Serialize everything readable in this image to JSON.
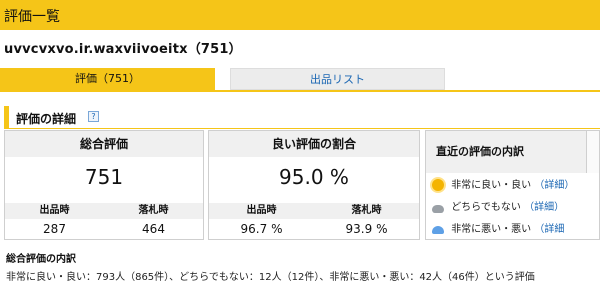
{
  "page": {
    "title": "評価一覧",
    "user_line": "uvvcvxvo.ir.waxviivoeitx（751）"
  },
  "tabs": {
    "active": "評価（751）",
    "inactive": "出品リスト"
  },
  "section": {
    "title": "評価の詳細",
    "help_icon_label": "?"
  },
  "box1": {
    "heading": "総合評価",
    "big_value": "751",
    "left_label": "出品時",
    "left_value": "287",
    "right_label": "落札時",
    "right_value": "464"
  },
  "box2": {
    "heading": "良い評価の割合",
    "big_value": "95.0 %",
    "left_label": "出品時",
    "left_value": "96.7 %",
    "right_label": "落札時",
    "right_value": "93.9 %"
  },
  "box3": {
    "heading": "直近の評価の内訳",
    "rows": [
      {
        "label": "非常に良い・良い",
        "link": "（詳細）",
        "icon": "sun-icon"
      },
      {
        "label": "どちらでもない",
        "link": "（詳細）",
        "icon": "cloud-icon"
      },
      {
        "label": "非常に悪い・悪い",
        "link": "（詳細",
        "icon": "rain-icon"
      }
    ]
  },
  "summary": {
    "title": "総合評価の内訳",
    "text": "非常に良い・良い：793人（865件）、どちらでもない：12人（12件）、非常に悪い・悪い：42人（46件）という評価"
  },
  "colors": {
    "accent": "#f5c518",
    "link": "#1a66b3",
    "header_bg": "#f0f0f0"
  }
}
